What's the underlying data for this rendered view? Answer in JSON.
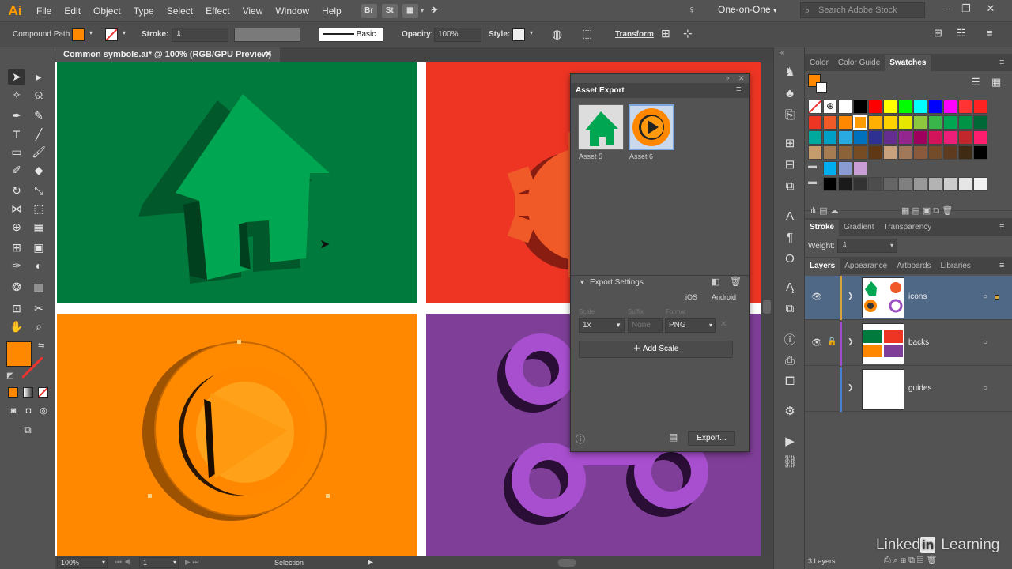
{
  "app": {
    "logo": "Ai"
  },
  "menu": [
    "File",
    "Edit",
    "Object",
    "Type",
    "Select",
    "Effect",
    "View",
    "Window",
    "Help"
  ],
  "menu_buttons": [
    "Br",
    "St"
  ],
  "workspace": "One-on-One",
  "search_placeholder": "Search Adobe Stock",
  "control": {
    "selection_type": "Compound Path",
    "stroke_label": "Stroke:",
    "brush": "Basic",
    "opacity_label": "Opacity:",
    "opacity": "100%",
    "style_label": "Style:",
    "transform": "Transform",
    "fill_color": "#ff8800"
  },
  "document_tab": "Common symbols.ai* @ 100% (RGB/GPU Preview)",
  "canvas": {
    "colors": {
      "green": "#008040",
      "red": "#ee3524",
      "orange": "#ff8800",
      "purple": "#7f3f98",
      "house": "#00a651",
      "gear": "#f05a28",
      "play_dark": "#cc6a00",
      "link": "#9b4fc0"
    }
  },
  "asset_export": {
    "title": "Asset Export",
    "assets": [
      {
        "label": "Asset 5"
      },
      {
        "label": "Asset 6"
      }
    ],
    "export_settings": "Export Settings",
    "platforms": [
      "iOS",
      "Android"
    ],
    "col_headers": [
      "Scale",
      "Suffix",
      "Format"
    ],
    "scale": "1x",
    "suffix_placeholder": "None",
    "format": "PNG",
    "add_scale": "Add Scale",
    "export_button": "Export..."
  },
  "color_panel": {
    "tabs": [
      "Color",
      "Color Guide",
      "Swatches"
    ],
    "active_tab": "Swatches"
  },
  "stroke_panel": {
    "tabs": [
      "Stroke",
      "Gradient",
      "Transparency"
    ],
    "weight_label": "Weight:"
  },
  "layers_panel": {
    "tabs": [
      "Layers",
      "Appearance",
      "Artboards",
      "Libraries"
    ],
    "layers": [
      {
        "name": "icons",
        "color": "#d8a33a"
      },
      {
        "name": "backs",
        "color": "#9a4fd3"
      },
      {
        "name": "guides",
        "color": "#4a7fd6"
      }
    ],
    "count": "3 Layers"
  },
  "status": {
    "zoom": "100%",
    "artboard": "1",
    "tool": "Selection"
  },
  "watermark": {
    "brand": "Linked",
    "brand_in": "in",
    "product": "Learning"
  }
}
